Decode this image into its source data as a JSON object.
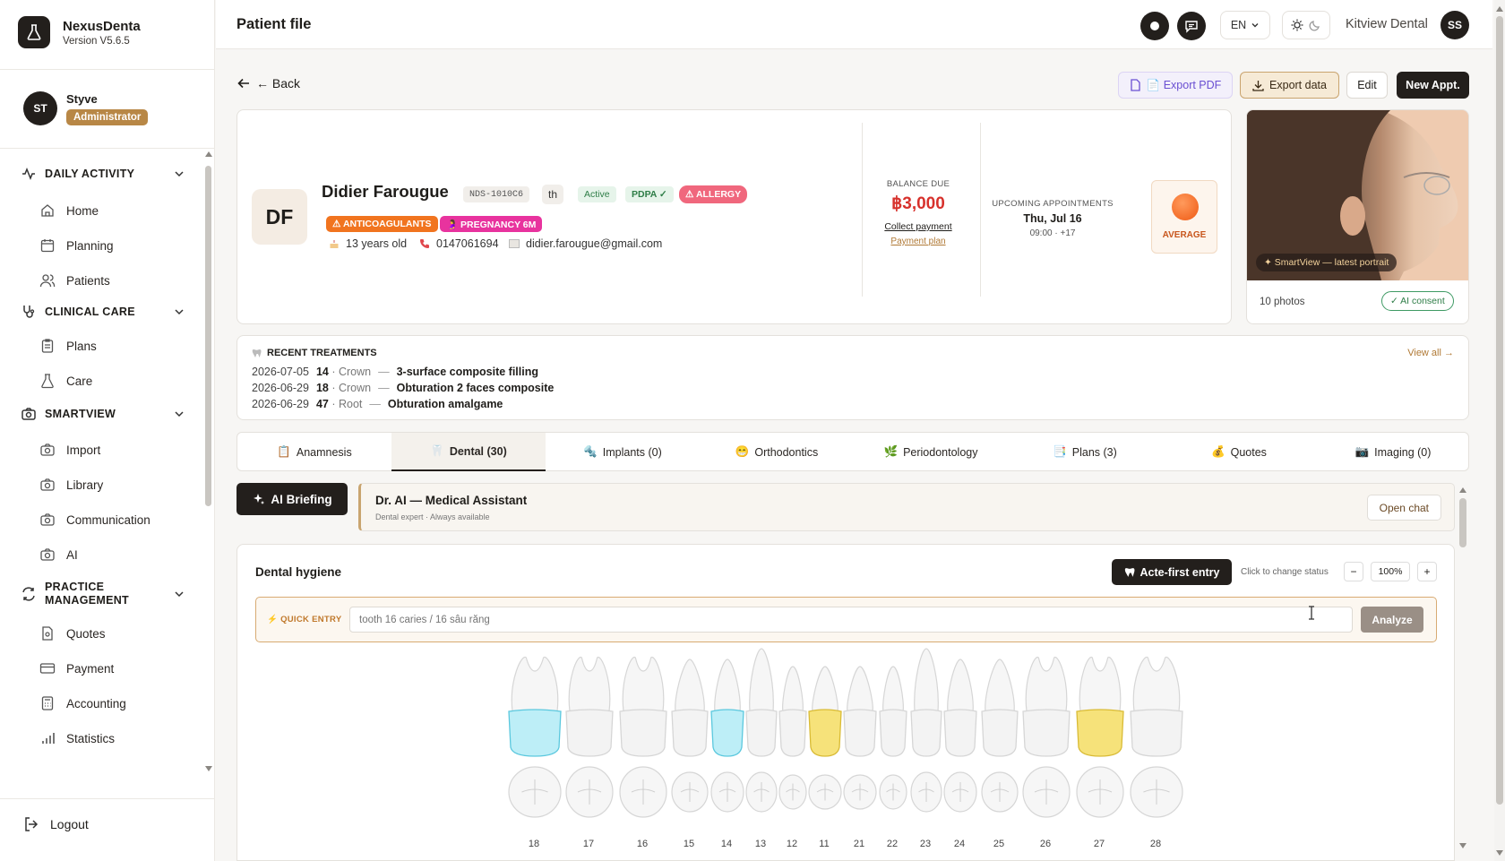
{
  "app": {
    "name": "NexusDenta",
    "version": "Version V5.6.5"
  },
  "user": {
    "initials": "ST",
    "name": "Styve",
    "role": "Administrator"
  },
  "nav": {
    "sections": [
      {
        "label": "DAILY ACTIVITY",
        "items": [
          "Home",
          "Planning",
          "Patients"
        ]
      },
      {
        "label": "CLINICAL CARE",
        "items": [
          "Plans",
          "Care"
        ]
      },
      {
        "label": "SMARTVIEW",
        "items": [
          "Import",
          "Library",
          "Communication",
          "AI"
        ]
      },
      {
        "label": "PRACTICE MANAGEMENT",
        "items": [
          "Quotes",
          "Payment",
          "Accounting",
          "Statistics"
        ]
      }
    ],
    "logout": "Logout"
  },
  "topbar": {
    "title": "Patient file",
    "lang": "EN",
    "clinic": "Kitview Dental",
    "avatar": "SS"
  },
  "actions": {
    "back": "← Back",
    "export_pdf": "📄 Export PDF",
    "export_data": "Export data",
    "edit": "Edit",
    "new_appt": "New Appt."
  },
  "patient": {
    "initials": "DF",
    "name": "Didier Farougue",
    "id": "NDS-1010C6",
    "lang": "th",
    "status": "Active",
    "pdpa": "PDPA ✓",
    "allergy": "⚠ ALLERGY",
    "anticoag": "⚠ ANTICOAGULANTS",
    "pregnancy": "🤰 PREGNANCY 6M",
    "age": "13 years old",
    "phone": "0147061694",
    "email": "didier.farougue@gmail.com",
    "balance_label": "BALANCE DUE",
    "balance": "฿3,000",
    "collect": "Collect payment",
    "payment_plan": "Payment plan",
    "upcoming_label": "UPCOMING APPOINTMENTS",
    "upcoming_date": "Thu, Jul 16",
    "upcoming_time": "09:00 · +17",
    "risk": "AVERAGE"
  },
  "photo": {
    "caption": "✦ SmartView — latest portrait",
    "count": "10 photos",
    "consent": "✓ AI consent"
  },
  "recent": {
    "title": "RECENT TREATMENTS",
    "view_all": "View all →",
    "rows": [
      {
        "date": "2026-07-05",
        "tooth": "14",
        "type": "· Crown",
        "dash": "—",
        "desc": "3-surface composite filling"
      },
      {
        "date": "2026-06-29",
        "tooth": "18",
        "type": "· Crown",
        "dash": "—",
        "desc": "Obturation 2 faces composite"
      },
      {
        "date": "2026-06-29",
        "tooth": "47",
        "type": "· Root",
        "dash": "—",
        "desc": "Obturation amalgame"
      }
    ]
  },
  "tabs": [
    {
      "icon": "📋",
      "label": "Anamnesis"
    },
    {
      "icon": "🦷",
      "label": "Dental (30)"
    },
    {
      "icon": "🔩",
      "label": "Implants (0)"
    },
    {
      "icon": "😁",
      "label": "Orthodontics"
    },
    {
      "icon": "🌿",
      "label": "Periodontology"
    },
    {
      "icon": "📑",
      "label": "Plans (3)"
    },
    {
      "icon": "💰",
      "label": "Quotes"
    },
    {
      "icon": "📷",
      "label": "Imaging (0)"
    }
  ],
  "ai": {
    "button": "AI Briefing",
    "title": "Dr. AI — Medical Assistant",
    "subtitle": "Dental expert · Always available",
    "open": "Open chat"
  },
  "chart": {
    "title": "Dental hygiene",
    "acte": "Acte-first entry",
    "hint": "Click to change status",
    "zoom": "100%",
    "minus": "−",
    "plus": "+",
    "quick_label": "⚡ QUICK ENTRY",
    "placeholder": "tooth 16 caries / 16 sâu răng",
    "analyze": "Analyze",
    "teeth": [
      {
        "n": "18",
        "status": "treated"
      },
      {
        "n": "17",
        "status": "healthy"
      },
      {
        "n": "16",
        "status": "healthy"
      },
      {
        "n": "15",
        "status": "healthy"
      },
      {
        "n": "14",
        "status": "treated"
      },
      {
        "n": "13",
        "status": "healthy"
      },
      {
        "n": "12",
        "status": "healthy"
      },
      {
        "n": "11",
        "status": "watch"
      },
      {
        "n": "21",
        "status": "healthy"
      },
      {
        "n": "22",
        "status": "healthy"
      },
      {
        "n": "23",
        "status": "healthy"
      },
      {
        "n": "24",
        "status": "healthy"
      },
      {
        "n": "25",
        "status": "healthy"
      },
      {
        "n": "26",
        "status": "healthy"
      },
      {
        "n": "27",
        "status": "watch"
      },
      {
        "n": "28",
        "status": "healthy"
      }
    ],
    "colors": {
      "treated": "#bdeef7",
      "watch": "#f6e27a",
      "healthy": "#f3f3f3"
    }
  }
}
